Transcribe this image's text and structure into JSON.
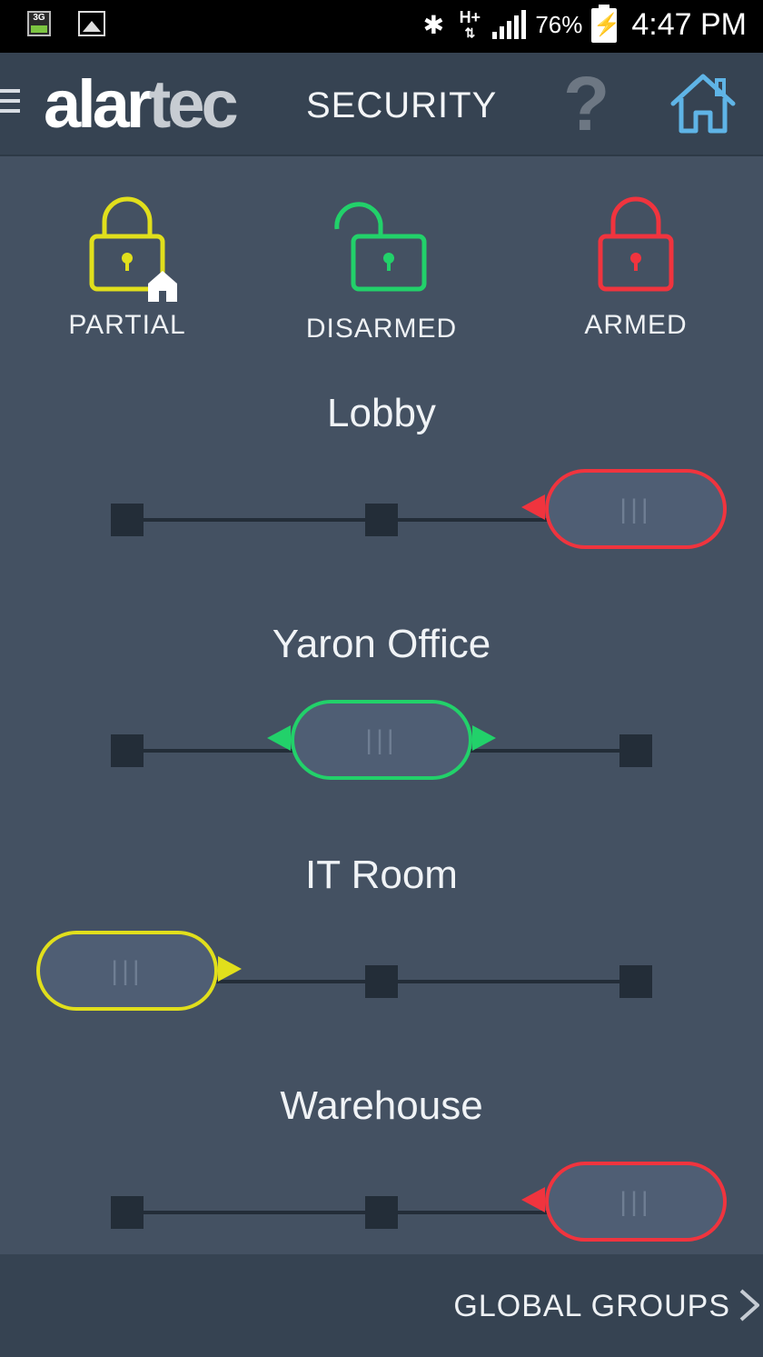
{
  "status_bar": {
    "network_badge": "3G",
    "data_type": "H+",
    "battery_percent": "76%",
    "time": "4:47 PM",
    "icons": [
      "3g-icon",
      "image-icon",
      "bluetooth-icon",
      "signal-icon",
      "battery-charging-icon"
    ]
  },
  "header": {
    "logo_part1": "alar",
    "logo_part2": "tec",
    "title": "SECURITY",
    "help_label": "?",
    "icons": [
      "menu-icon",
      "help-icon",
      "home-icon"
    ]
  },
  "modes": [
    {
      "label": "PARTIAL",
      "color": "#e1df1c",
      "icon": "lock-home-icon"
    },
    {
      "label": "DISARMED",
      "color": "#22d16a",
      "icon": "lock-open-icon"
    },
    {
      "label": "ARMED",
      "color": "#f0343e",
      "icon": "lock-closed-icon"
    }
  ],
  "zones": [
    {
      "name": "Lobby",
      "state": "ARMED",
      "position": 2,
      "color": "#f0343e"
    },
    {
      "name": "Yaron Office",
      "state": "DISARMED",
      "position": 1,
      "color": "#22d16a"
    },
    {
      "name": "IT Room",
      "state": "PARTIAL",
      "position": 0,
      "color": "#e1df1c"
    },
    {
      "name": "Warehouse",
      "state": "ARMED",
      "position": 2,
      "color": "#f0343e"
    }
  ],
  "slider_grip": "|||",
  "footer": {
    "global_groups_label": "GLOBAL GROUPS"
  }
}
